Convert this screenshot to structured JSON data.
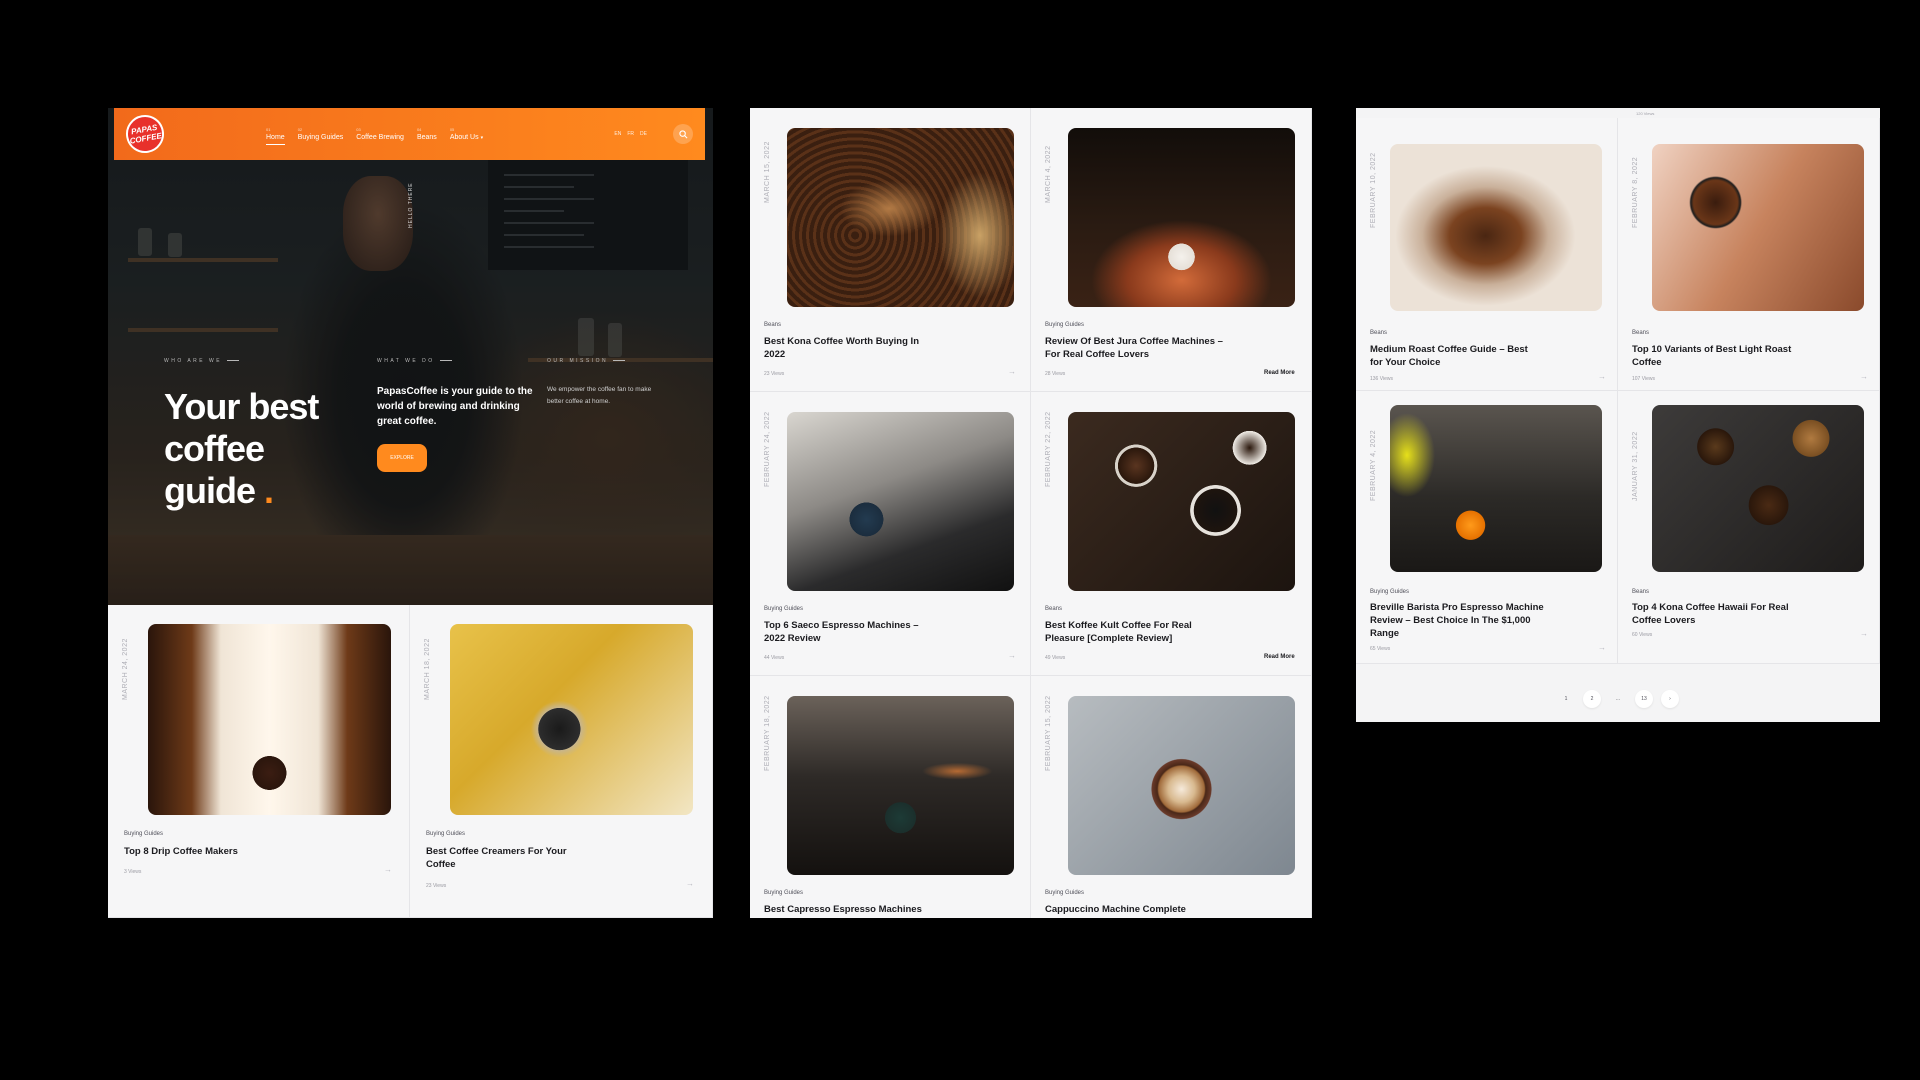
{
  "nav": {
    "logo_text": "PAPAS COFFEE",
    "menu": [
      {
        "num": "01",
        "label": "Home"
      },
      {
        "num": "02",
        "label": "Buying Guides"
      },
      {
        "num": "03",
        "label": "Coffee Brewing"
      },
      {
        "num": "04",
        "label": "Beans"
      },
      {
        "num": "05",
        "label": "About Us"
      }
    ],
    "langs": [
      "EN",
      "FR",
      "DE"
    ],
    "accent": "#ff8a1e"
  },
  "hero": {
    "hello": "HELLO THERE",
    "who": "WHO ARE WE",
    "what": "WHAT WE DO",
    "mission": "OUR MISSION",
    "title": "Your best\ncoffee\nguide",
    "dot": ".",
    "lead": "PapasCoffee is your guide to the world of brewing and drinking great coffee.",
    "side": "We empower the coffee fan to make better coffee at home.",
    "explore": "EXPLORE"
  },
  "panel1_cards": [
    {
      "date": "MARCH 24, 2022",
      "category": "Buying Guides",
      "title": "Top 8 Drip Coffee Makers",
      "views": "3 Views"
    },
    {
      "date": "MARCH 18, 2022",
      "category": "Buying Guides",
      "title": "Best Coffee Creamers For Your Coffee",
      "views": "23 Views"
    }
  ],
  "panel2_cards": [
    {
      "date": "MARCH 15, 2022",
      "category": "Beans",
      "title": "Best Kona Coffee Worth Buying In 2022",
      "views": "23 Views",
      "readmore": ""
    },
    {
      "date": "MARCH 4, 2022",
      "category": "Buying Guides",
      "title": "Review Of Best Jura Coffee Machines – For Real Coffee Lovers",
      "views": "28 Views",
      "readmore": "Read More"
    },
    {
      "date": "FEBRUARY 24, 2022",
      "category": "Buying Guides",
      "title": "Top 6 Saeco Espresso Machines – 2022 Review",
      "views": "44 Views",
      "readmore": ""
    },
    {
      "date": "FEBRUARY 22, 2022",
      "category": "Beans",
      "title": "Best Koffee Kult Coffee For Real Pleasure [Complete Review]",
      "views": "49 Views",
      "readmore": "Read More"
    },
    {
      "date": "FEBRUARY 18, 2022",
      "category": "Buying Guides",
      "title": "Best Capresso Espresso Machines",
      "views": "",
      "readmore": ""
    },
    {
      "date": "FEBRUARY 15, 2022",
      "category": "Buying Guides",
      "title": "Cappuccino Machine Complete",
      "views": "",
      "readmore": ""
    }
  ],
  "panel3_top_views": "120 Views",
  "panel3_cards": [
    {
      "date": "FEBRUARY 10, 2022",
      "category": "Beans",
      "title": "Medium Roast Coffee Guide – Best for Your Choice",
      "views": "136 Views"
    },
    {
      "date": "FEBRUARY 8, 2022",
      "category": "Beans",
      "title": "Top 10 Variants of Best Light Roast Coffee",
      "views": "107 Views"
    },
    {
      "date": "FEBRUARY 4, 2022",
      "category": "Buying Guides",
      "title": "Breville Barista Pro Espresso Machine Review – Best Choice In The $1,000 Range",
      "views": "65 Views"
    },
    {
      "date": "JANUARY 31, 2022",
      "category": "Beans",
      "title": "Top 4 Kona Coffee Hawaii For Real Coffee Lovers",
      "views": "60 Views"
    }
  ],
  "pagination": [
    "1",
    "2",
    "...",
    "13",
    "›"
  ]
}
